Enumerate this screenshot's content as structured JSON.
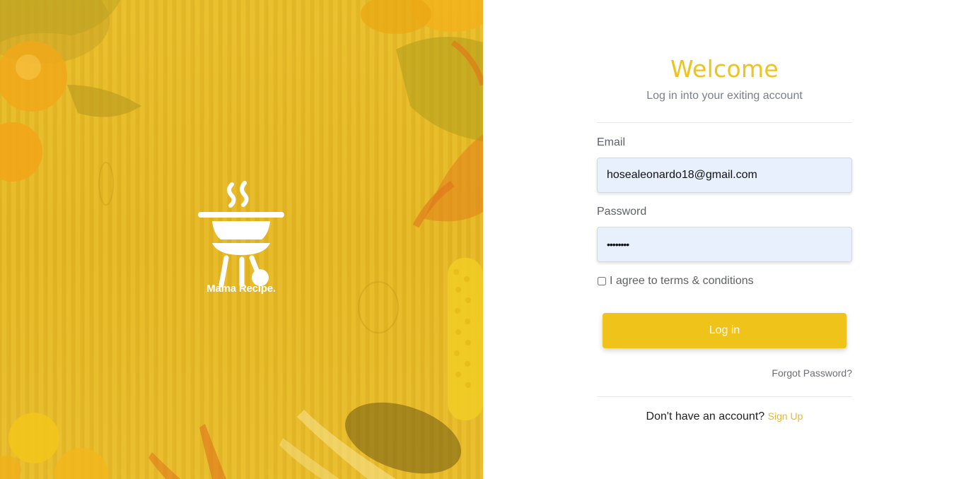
{
  "brand": {
    "name": "Mama Recipe."
  },
  "form": {
    "title": "Welcome",
    "subtitle": "Log in into your exiting account",
    "email_label": "Email",
    "email_value": "hosealeonardo18@gmail.com",
    "password_label": "Password",
    "password_value": "••••••••",
    "agree_label": "I agree to terms & conditions",
    "agree_checked": false,
    "login_label": "Log in",
    "forgot_label": "Forgot Password?",
    "no_account_text": "Don't have an account?",
    "signup_label": "Sign Up"
  },
  "colors": {
    "accent": "#efc31a",
    "hero_yellow": "#e8bc28",
    "input_bg": "#e8f0fe"
  },
  "icons": {
    "logo": "barbecue-grill-icon"
  }
}
